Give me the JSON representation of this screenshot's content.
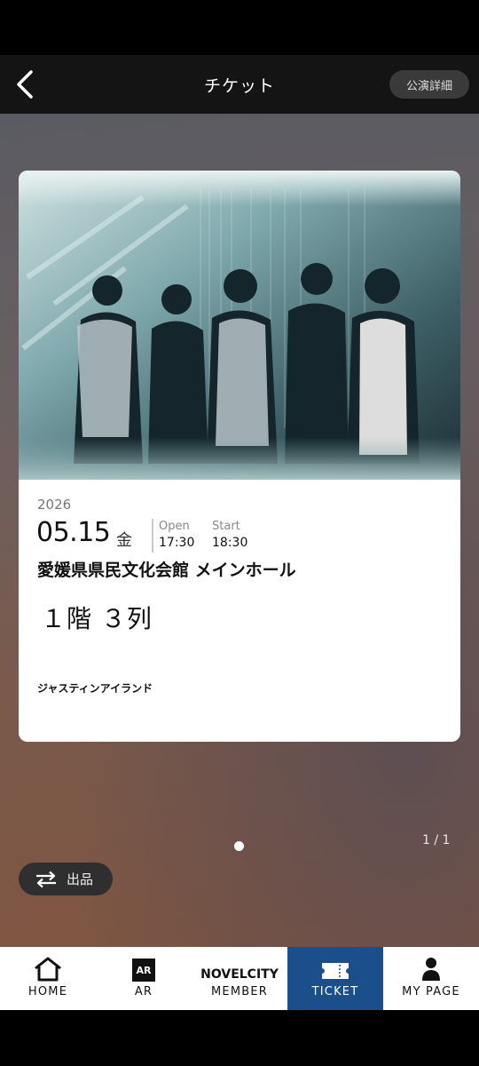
{
  "header": {
    "title": "チケット",
    "detail_label": "公演詳細"
  },
  "ticket": {
    "year": "2026",
    "date": "05.15",
    "weekday": "金",
    "open_label": "Open",
    "open_time": "17:30",
    "start_label": "Start",
    "start_time": "18:30",
    "venue": "愛媛県県民文化会館 メインホール",
    "seat": "１階 ３列",
    "artist": "ジャスティンアイランド"
  },
  "pager": {
    "count": "1 / 1"
  },
  "sell_button": {
    "label": "出品"
  },
  "tabs": [
    {
      "label": "HOME",
      "icon": "home-icon"
    },
    {
      "label": "AR",
      "icon": "ar-icon",
      "icon_text": "AR"
    },
    {
      "label": "MEMBER",
      "icon": "novelcity-logo",
      "icon_text": "NOVELCITY"
    },
    {
      "label": "TICKET",
      "icon": "ticket-icon",
      "active": true
    },
    {
      "label": "MY PAGE",
      "icon": "person-icon"
    }
  ],
  "colors": {
    "active_tab": "#1b4f8c",
    "header": "#141414",
    "card": "#ffffff"
  }
}
